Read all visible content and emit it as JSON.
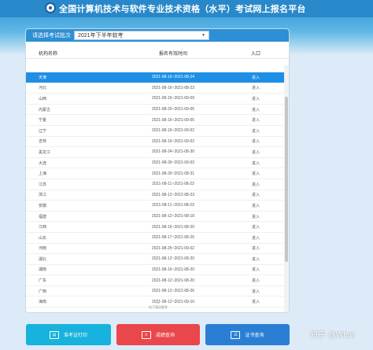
{
  "header": {
    "title": "全国计算机技术与软件专业技术资格（水平）考试网上报名平台"
  },
  "filter": {
    "label": "请选择考试批次",
    "selected": "2021年下半年软考"
  },
  "table": {
    "columns": [
      "机构名称",
      "报名有效时间",
      "入口"
    ],
    "rows": [
      {
        "name": "天津",
        "period": "2021-08-16~2021-08-24",
        "entry": "进入"
      },
      {
        "name": "河北",
        "period": "2021-08-16~2021-08-23",
        "entry": "进入"
      },
      {
        "name": "山西",
        "period": "2021-08-16~2021-09-09",
        "entry": "进入"
      },
      {
        "name": "内蒙古",
        "period": "2021-08-20~2021-09-05",
        "entry": "进入"
      },
      {
        "name": "宁夏",
        "period": "2021-08-16~2021-09-05",
        "entry": "进入"
      },
      {
        "name": "辽宁",
        "period": "2021-08-16~2021-09-02",
        "entry": "进入"
      },
      {
        "name": "吉林",
        "period": "2021-08-16~2021-09-02",
        "entry": "进入"
      },
      {
        "name": "黑龙江",
        "period": "2021-08-24~2021-08-30",
        "entry": "进入"
      },
      {
        "name": "大连",
        "period": "2021-08-30~2021-09-03",
        "entry": "进入"
      },
      {
        "name": "上海",
        "period": "2021-08-30~2021-08-31",
        "entry": "进入"
      },
      {
        "name": "江苏",
        "period": "2021-08-11~2021-08-23",
        "entry": "进入"
      },
      {
        "name": "浙江",
        "period": "2021-08-12~2021-08-23",
        "entry": "进入"
      },
      {
        "name": "安徽",
        "period": "2021-08-11~2021-08-23",
        "entry": "进入"
      },
      {
        "name": "福建",
        "period": "2021-08-12~2021-08-18",
        "entry": "进入"
      },
      {
        "name": "江西",
        "period": "2021-08-16~2021-08-20",
        "entry": "进入"
      },
      {
        "name": "山东",
        "period": "2021-08-17~2021-08-26",
        "entry": "进入"
      },
      {
        "name": "河南",
        "period": "2021-08-25~2021-09-02",
        "entry": "进入"
      },
      {
        "name": "湖北",
        "period": "2021-08-12~2021-08-20",
        "entry": "进入"
      },
      {
        "name": "湖南",
        "period": "2021-08-16~2021-08-20",
        "entry": "进入"
      },
      {
        "name": "广东",
        "period": "2021-08-12~2021-08-20",
        "entry": "进入"
      },
      {
        "name": "广西",
        "period": "2021-08-12~2021-08-26",
        "entry": "进入"
      },
      {
        "name": "海南",
        "period": "2021-08-12~2021-09-10",
        "entry": "进入"
      }
    ],
    "more_hint": "向下滚动更多"
  },
  "actions": {
    "print_admission": "准考证打印",
    "score_query": "成绩查询",
    "certificate_query": "证书查询"
  },
  "watermark": "知乎 @What",
  "icons": {
    "logo": "seal-logo-icon",
    "dropdown": "chevron-down-icon",
    "more": "chevron-down-icon",
    "print": "admission-card-icon",
    "score": "score-sheet-icon",
    "certificate": "certificate-icon"
  },
  "colors": {
    "header_bg": "#2888c9",
    "panel_head": "#2d8fd5",
    "selected_row": "#1e8fe6",
    "btn_print": "#17b2dd",
    "btn_score": "#e9474c",
    "btn_cert": "#2a7fd5"
  }
}
